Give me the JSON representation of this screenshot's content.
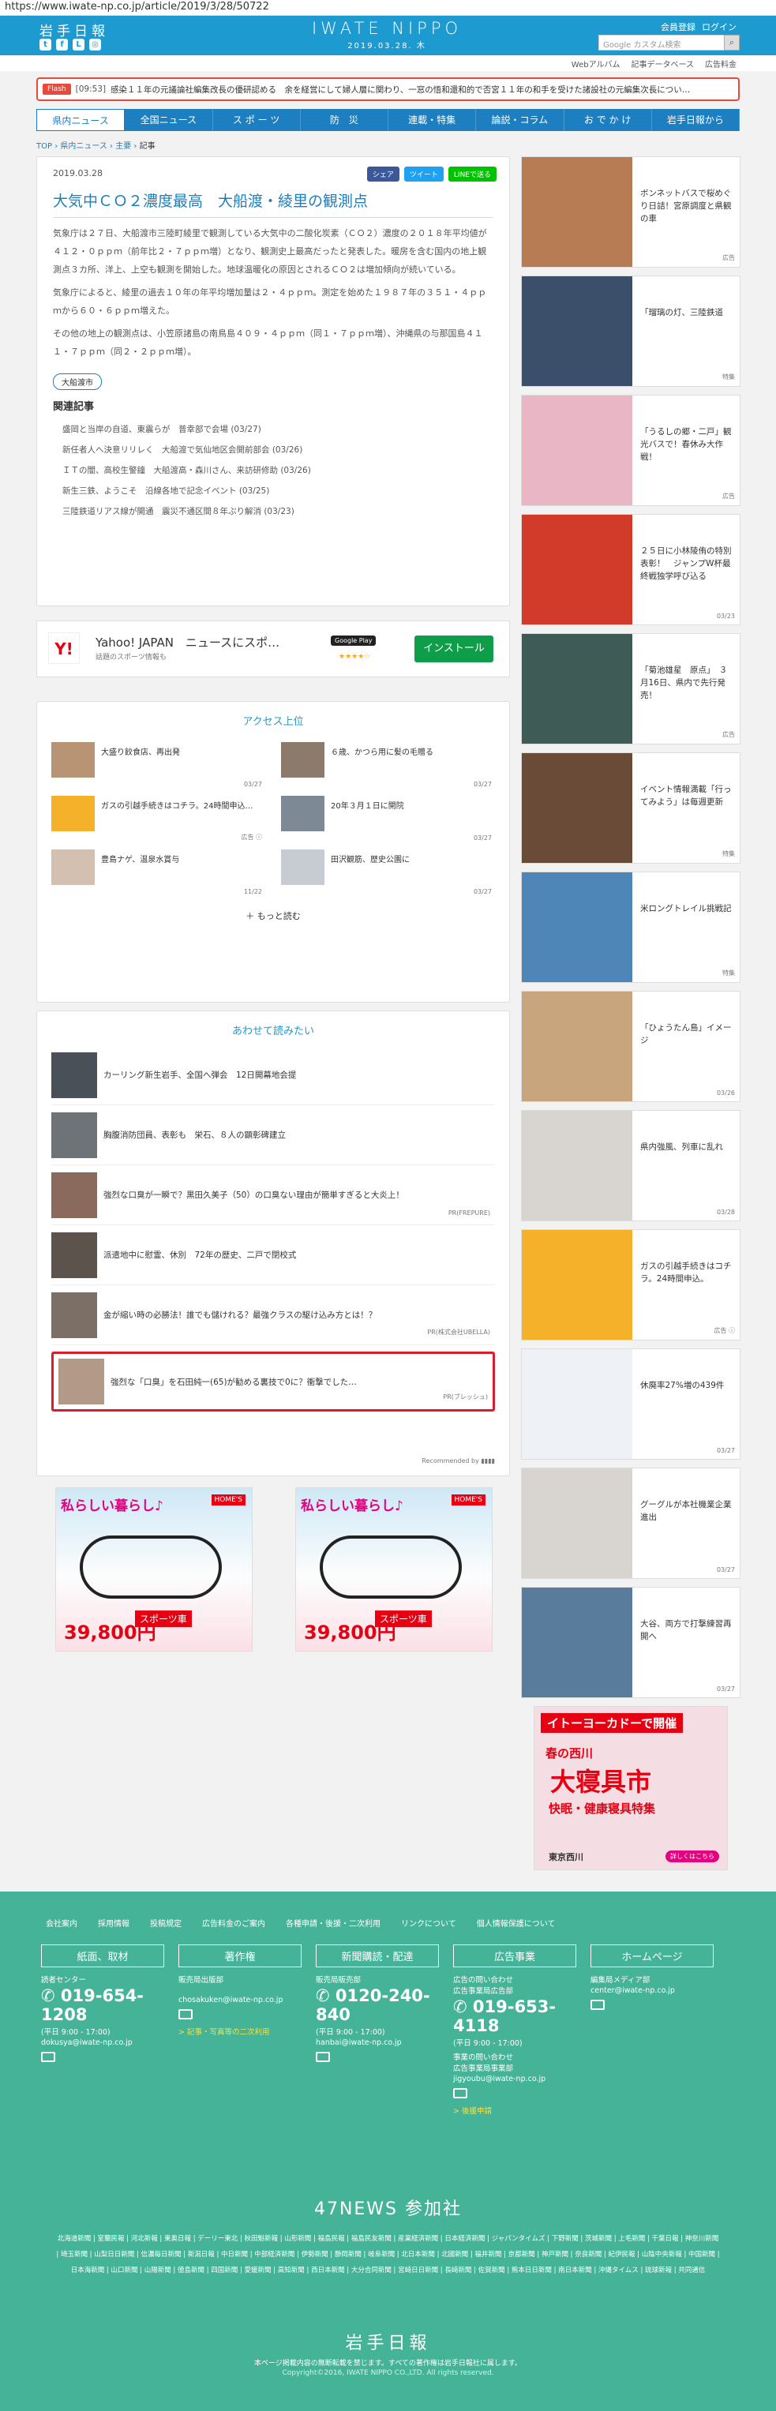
{
  "url": "https://www.iwate-np.co.jp/article/2019/3/28/50722",
  "header": {
    "logo_text": "岩手日報",
    "brand": "IWATE NIPPO",
    "date": "2019.03.28. 木",
    "register": "会員登録",
    "login": "ログイン",
    "search_placeholder": "Google カスタム検索",
    "search_icon": "magnifier-icon"
  },
  "subnav": [
    "Webアルバム",
    "記事データベース",
    "広告料金"
  ],
  "flash": {
    "tag": "Flash",
    "time": "[09:53]",
    "text": "感染１１年の元議論社編集改長の優研認める　余を経営にして婦人層に関わり、一窓の悟和還和的で否宮１１年の和手を受けた諸設社の元編集次長につい…"
  },
  "gnav": [
    "県内ニュース",
    "全国ニュース",
    "ス ポ ー ツ",
    "防　災",
    "連載・特集",
    "論説・コラム",
    "お で か け",
    "岩手日報から"
  ],
  "breadcrumb": [
    "TOP",
    "県内ニュース",
    "主要",
    "記事"
  ],
  "article": {
    "date": "2019.03.28",
    "share_fb": "シェア",
    "share_tw": "ツイート",
    "share_line": "LINEで送る",
    "title": "大気中ＣＯ２濃度最高　大船渡・綾里の観測点",
    "paragraphs": [
      "気象庁は２７日、大船渡市三陸町綾里で観測している大気中の二酸化炭素（ＣＯ２）濃度の２０１８年平均値が４１２・０ｐｐｍ（前年比２・７ｐｐｍ増）となり、観測史上最高だったと発表した。暖房を含む国内の地上観測点３カ所、洋上、上空も観測を開始した。地球温暖化の原因とされるＣＯ２は増加傾向が続いている。",
      "気象庁によると、綾里の過去１０年の年平均増加量は２・４ｐｐｍ。測定を始めた１９８７年の３５１・４ｐｐｍから６０・６ｐｐｍ増えた。",
      "その他の地上の観測点は、小笠原諸島の南鳥島４０９・４ｐｐｍ（同１・７ｐｐｍ増）、沖縄県の与那国島４１１・７ｐｐｍ（同２・２ｐｐｍ増）。"
    ],
    "place_tag": "大船渡市",
    "related_heading": "関連記事",
    "related": [
      "盛岡と当岸の自道、東震らが　普幸部で会場 (03/27)",
      "新任者人へ決意リリレく　大船渡で気仙地区会開前部会 (03/26)",
      "ＩＴの闇、高校生警鐘　大船渡高・森川さん、来訪研修助 (03/26)",
      "新生三鉄、ようこそ　沿線各地で記念イベント (03/25)",
      "三陸鉄道リアス線が開通　震災不通区間８年ぶり解消 (03/23)"
    ]
  },
  "ad_banner": {
    "app_name": "Yahoo! JAPAN　ニュースにスポ…",
    "sub": "話題のスポーツ情報も",
    "store": "Google Play",
    "stars": "★★★★☆",
    "button": "インストール",
    "logo": "Y!"
  },
  "ranking": {
    "title": "アクセス上位",
    "items": [
      {
        "text": "大盛り餃食店、再出発",
        "date": "03/27"
      },
      {
        "text": "６歳、かつら用に髪の毛贈る",
        "date": "03/27"
      },
      {
        "text": "ガスの引越手続きはコチラ。24時間申込…",
        "date": "広告 ⓘ"
      },
      {
        "text": "20年３月１日に開院",
        "date": "03/27"
      },
      {
        "text": "豊島ナゲ、温泉水賞与",
        "date": "11/22"
      },
      {
        "text": "田沢観筋、歴史公園に",
        "date": "03/27"
      }
    ],
    "more": "もっと読む"
  },
  "recommend": {
    "title": "あわせて読みたい",
    "items": [
      {
        "text": "カーリング新生岩手、全国へ弾会　12日開幕地会提",
        "pr": ""
      },
      {
        "text": "胸腹消防団員、表彰も　栄石、８人の顕彰碑建立",
        "pr": ""
      },
      {
        "text": "強烈な口臭が一瞬で？黒田久美子（50）の口臭ない理由が簡単すぎると大炎上！",
        "pr": "PR(FREPURE)"
      },
      {
        "text": "派遣地中に慰霊、休別　72年の歴史、二戸で閉校式",
        "pr": ""
      },
      {
        "text": "金が縮い時の必勝法！誰でも儲けれる？最強クラスの駆け込み方とは！？",
        "pr": "PR(株式会社UBELLA)"
      },
      {
        "text": "強烈な「口臭」を石田純一(65)が勧める裏技で0に？衝撃でした…",
        "pr": "PR(ブレッシュ)"
      }
    ],
    "recommended_by": "Recommended by ▮▮▮▮"
  },
  "ads_bottom": [
    {
      "tag": "私らしい暮らし♪",
      "brand": "HOME'S",
      "price": "39,800円",
      "cta": "スポーツ車"
    },
    {
      "tag": "私らしい暮らし♪",
      "brand": "HOME'S",
      "price": "39,800円",
      "cta": "スポーツ車"
    }
  ],
  "sidebar": [
    {
      "text": "ボンネットバスで桜めぐり日詰！宮原調度と県観の車",
      "date": "広告",
      "color": "#b87c55"
    },
    {
      "text": "「瑠璃の灯、三陸鉄道",
      "date": "特集",
      "color": "#3b4e6a"
    },
    {
      "text": "「うるしの郷・二戸」観光バスで！春休み大作戦！",
      "date": "広告",
      "color": "#e8b6c4"
    },
    {
      "text": "２５日に小林陵侑の特別表彰！　ジャンプW杯最終戦独学呼び込る",
      "date": "03/23",
      "color": "#d23a2a"
    },
    {
      "text": "「菊池雄星　原点」　３月16日、県内で先行発売！",
      "date": "広告",
      "color": "#3e5b55"
    },
    {
      "text": "イベント情報満載「行ってみよう」は毎週更新",
      "date": "特集",
      "color": "#6a4b38"
    },
    {
      "text": "米ロングトレイル挑戦記",
      "date": "特集",
      "color": "#4e86b8"
    },
    {
      "text": "「ひょうたん島」イメージ",
      "date": "03/26",
      "color": "#c9a57d"
    },
    {
      "text": "県内強風、列車に乱れ",
      "date": "03/28",
      "color": "#d8d4d0"
    },
    {
      "text": "ガスの引越手続きはコチラ。24時間申込。",
      "date": "広告 ⓘ",
      "color": "#f5b129"
    },
    {
      "text": "休廃率27%増の439件",
      "date": "03/27",
      "color": "#eef2f6"
    },
    {
      "text": "グーグルが本社機業企業進出",
      "date": "03/27",
      "color": "#d8d4d0"
    },
    {
      "text": "大谷、両方で打撃練習再開へ",
      "date": "03/27",
      "color": "#5a7c9c"
    }
  ],
  "side_ad": {
    "b1": "イトーヨーカドーで開催",
    "b2": "春の西川",
    "b3": "大寝具市",
    "b4": "快眠・健康寝具特集",
    "b5": "東京西川",
    "b6": "詳しくはこちら"
  },
  "footer": {
    "links": [
      "会社案内",
      "採用情報",
      "投稿規定",
      "広告料金のご案内",
      "各種申請・後援・二次利用",
      "リンクについて",
      "個人情報保護について"
    ],
    "cols": [
      {
        "head": "紙面、取材",
        "l1": "読者センター",
        "phone": "019-654-1208",
        "hours": "(平日 9:00 - 17:00)",
        "mail": "dokusya@iwate-np.co.jp"
      },
      {
        "head": "著作権",
        "l1": "販売局出版部",
        "mail": "chosakuken@iwate-np.co.jp",
        "link": "> 記事・写真等の二次利用"
      },
      {
        "head": "新聞購読・配達",
        "l1": "販売局販売部",
        "phone": "0120-240-840",
        "hours": "(平日 9:00 - 17:00)",
        "mail": "hanbai@iwate-np.co.jp"
      },
      {
        "head": "広告事業",
        "l1": "広告の問い合わせ",
        "l2": "広告事業局広告部",
        "phone": "019-653-4118",
        "hours": "(平日 9:00 - 17:00)",
        "l3": "事業の問い合わせ",
        "l4": "広告事業局事業部",
        "mail": "jigyoubu@iwate-np.co.jp",
        "link": "> 後援申請"
      },
      {
        "head": "ホームページ",
        "l1": "編集局メディア部",
        "mail": "center@iwate-np.co.jp"
      }
    ],
    "title47": "47NEWS 参加社",
    "papers": "北海道新聞 | 室蘭民報 | 河北新報 | 東奥日報 | デーリー東北 | 秋田魁新報 | 山形新聞 | 福島民報 | 福島民友新聞 | 産業経済新聞 | 日本経済新聞 | ジャパンタイムズ | 下野新聞 | 茨城新聞 | 上毛新聞 | 千葉日報 | 神奈川新聞 | 埼玉新聞 | 山梨日日新聞 | 信濃毎日新聞 | 新潟日報 | 中日新聞 | 中部経済新聞 | 伊勢新聞 | 静岡新聞 | 岐阜新聞 | 北日本新聞 | 北國新聞 | 福井新聞 | 京都新聞 | 神戸新聞 | 奈良新聞 | 紀伊民報 | 山陰中央新報 | 中国新聞 | 日本海新聞 | 山口新聞 | 山陽新聞 | 徳島新聞 | 四国新聞 | 愛媛新聞 | 高知新聞 | 西日本新聞 | 大分合同新聞 | 宮崎日日新聞 | 長崎新聞 | 佐賀新聞 | 熊本日日新聞 | 南日本新聞 | 沖縄タイムス | 琉球新報 | 共同通信",
    "logo": "岩手日報",
    "copy": "本ページ掲載内容の無断転載を禁じます。すべての著作権は岩手日報社に属します。",
    "copy2": "Copyright©2016, IWATE NIPPO CO.,LTD. All rights reserved."
  }
}
